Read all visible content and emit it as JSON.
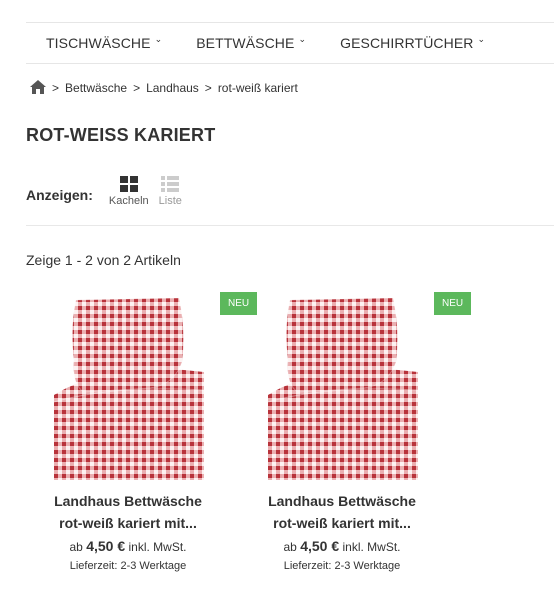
{
  "nav": {
    "items": [
      {
        "label": "TISCHWÄSCHE"
      },
      {
        "label": "BETTWÄSCHE"
      },
      {
        "label": "GESCHIRRTÜCHER"
      }
    ]
  },
  "breadcrumb": {
    "separator": ">",
    "items": [
      "Bettwäsche",
      "Landhaus",
      "rot-weiß kariert"
    ]
  },
  "page": {
    "title": "ROT-WEISS KARIERT"
  },
  "view": {
    "label": "Anzeigen:",
    "tiles_label": "Kacheln",
    "list_label": "Liste"
  },
  "results": {
    "text": "Zeige 1 - 2 von 2 Artikeln"
  },
  "products": [
    {
      "badge": "NEU",
      "name_line1": "Landhaus Bettwäsche",
      "name_line2": "rot-weiß kariert mit...",
      "price_prefix": "ab",
      "price": "4,50 €",
      "price_suffix": "inkl. MwSt.",
      "delivery": "Lieferzeit: 2-3 Werktage"
    },
    {
      "badge": "NEU",
      "name_line1": "Landhaus Bettwäsche",
      "name_line2": "rot-weiß kariert mit...",
      "price_prefix": "ab",
      "price": "4,50 €",
      "price_suffix": "inkl. MwSt.",
      "delivery": "Lieferzeit: 2-3 Werktage"
    }
  ],
  "colors": {
    "badge": "#5cb85c",
    "check_red": "#c7464c",
    "text": "#333333"
  }
}
